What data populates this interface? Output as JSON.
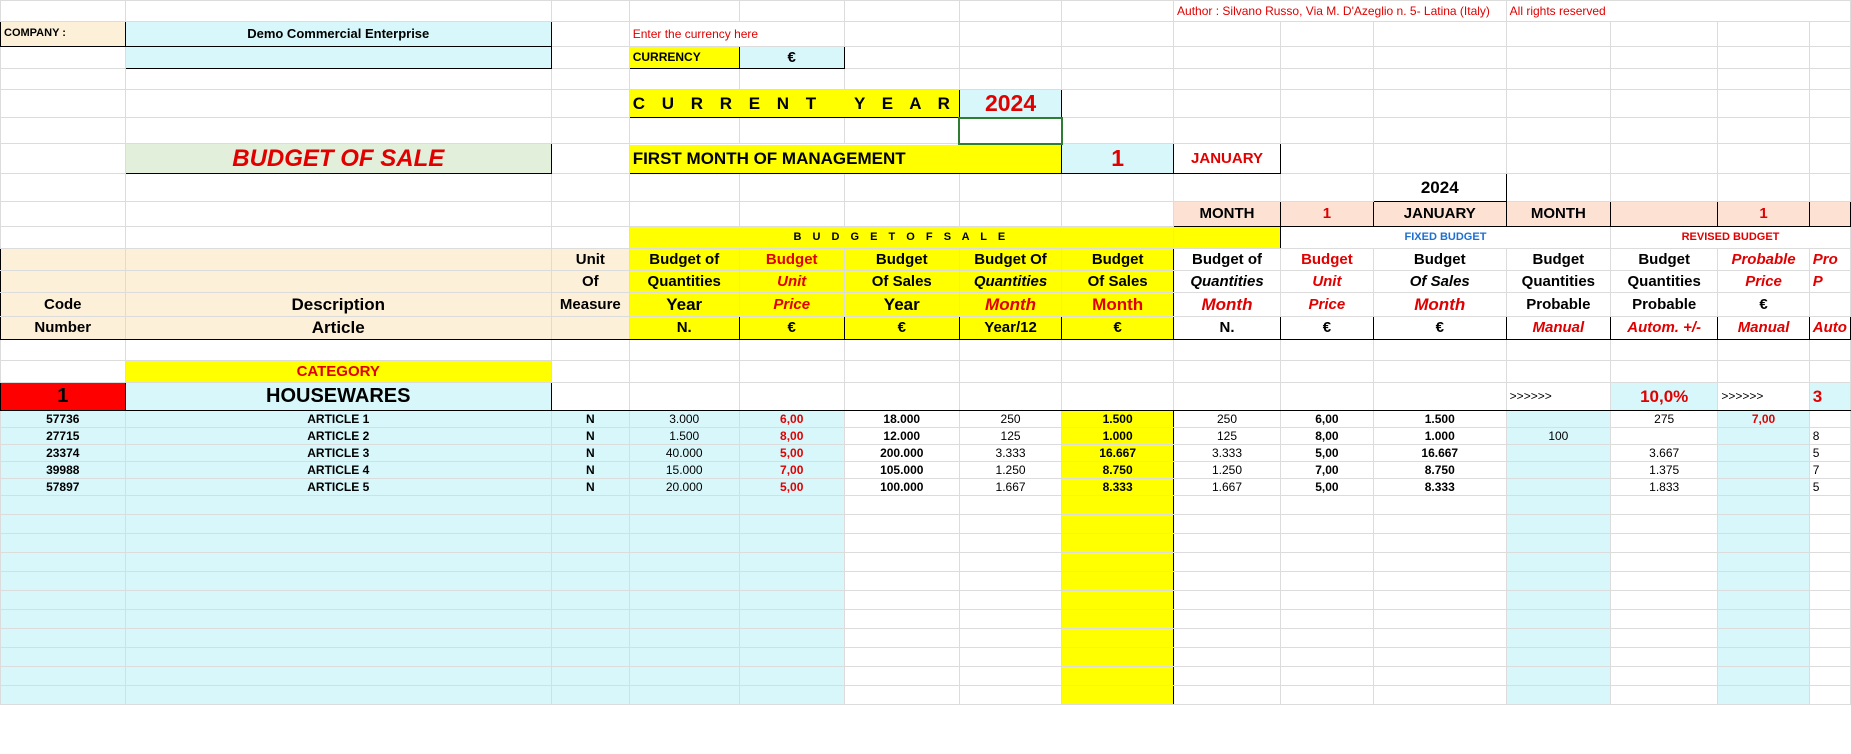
{
  "company": {
    "label": "COMPANY :",
    "name": "Demo Commercial Enterprise"
  },
  "author": "Author : Silvano Russo, Via M. D'Azeglio n. 5- Latina (Italy)",
  "rights": "All rights reserved",
  "currency": {
    "hint": "Enter the currency here",
    "label": "CURRENCY",
    "value": "€"
  },
  "current_year": {
    "label": "C U R R E N T   Y E A R",
    "value": "2024"
  },
  "sheet_title": "BUDGET OF SALE",
  "first_month": {
    "label": "FIRST MONTH OF MANAGEMENT",
    "number": "1",
    "name": "JANUARY"
  },
  "period": {
    "year": "2024",
    "month_label": "MONTH",
    "month_number": "1",
    "month_name": "JANUARY",
    "month_label_2": "MONTH",
    "month_number_2": "1"
  },
  "sections": {
    "budget_of_sale": "B U D G E T   O F   S A L E",
    "fixed_budget": "FIXED BUDGET",
    "revised_budget": "REVISED BUDGET"
  },
  "headers": {
    "code": [
      "Code",
      "Number"
    ],
    "description": [
      "Description",
      "Article"
    ],
    "unit": [
      "Unit",
      "Of",
      "Measure"
    ],
    "bq_year": [
      "Budget of",
      "Quantities",
      "Year",
      "N."
    ],
    "bup": [
      "Budget",
      "Unit",
      "Price",
      "€"
    ],
    "bos_year": [
      "Budget",
      "Of Sales",
      "Year",
      "€"
    ],
    "bq_month": [
      "Budget Of",
      "Quantities",
      "Month",
      "Year/12"
    ],
    "bos_month": [
      "Budget",
      "Of Sales",
      "Month",
      "€"
    ],
    "fb_q": [
      "Budget of",
      "Quantities",
      "Month",
      "N."
    ],
    "fb_p": [
      "Budget",
      "Unit",
      "Price",
      "€"
    ],
    "fb_s": [
      "Budget",
      "Of Sales",
      "Month",
      "€"
    ],
    "rb_qp": [
      "Budget",
      "Quantities",
      "Probable",
      "Manual"
    ],
    "rb_qp2": [
      "Budget",
      "Quantities",
      "Probable",
      "Autom. +/-"
    ],
    "rb_pp": [
      "Probable",
      "Price",
      "€",
      "Manual"
    ],
    "rb_pf": [
      "Pro",
      "P",
      "",
      "Auto"
    ]
  },
  "category": {
    "label": "CATEGORY",
    "number": "1",
    "name": "HOUSEWARES",
    "arrows_1": ">>>>>>",
    "pct": "10,0%",
    "arrows_2": ">>>>>>",
    "cut": "3"
  },
  "rows": [
    {
      "code": "57736",
      "desc": "ARTICLE 1",
      "unit": "N",
      "qy": "3.000",
      "price": "6,00",
      "sy": "18.000",
      "qm": "250",
      "sm": "1.500",
      "fq": "250",
      "fp": "6,00",
      "fs": "1.500",
      "rq": "",
      "rq2": "275",
      "rp": "7,00",
      "rpf": ""
    },
    {
      "code": "27715",
      "desc": "ARTICLE 2",
      "unit": "N",
      "qy": "1.500",
      "price": "8,00",
      "sy": "12.000",
      "qm": "125",
      "sm": "1.000",
      "fq": "125",
      "fp": "8,00",
      "fs": "1.000",
      "rq": "100",
      "rq2": "",
      "rp": "",
      "rpf": "8"
    },
    {
      "code": "23374",
      "desc": "ARTICLE 3",
      "unit": "N",
      "qy": "40.000",
      "price": "5,00",
      "sy": "200.000",
      "qm": "3.333",
      "sm": "16.667",
      "fq": "3.333",
      "fp": "5,00",
      "fs": "16.667",
      "rq": "",
      "rq2": "3.667",
      "rp": "",
      "rpf": "5"
    },
    {
      "code": "39988",
      "desc": "ARTICLE 4",
      "unit": "N",
      "qy": "15.000",
      "price": "7,00",
      "sy": "105.000",
      "qm": "1.250",
      "sm": "8.750",
      "fq": "1.250",
      "fp": "7,00",
      "fs": "8.750",
      "rq": "",
      "rq2": "1.375",
      "rp": "",
      "rpf": "7"
    },
    {
      "code": "57897",
      "desc": "ARTICLE 5",
      "unit": "N",
      "qy": "20.000",
      "price": "5,00",
      "sy": "100.000",
      "qm": "1.667",
      "sm": "8.333",
      "fq": "1.667",
      "fp": "5,00",
      "fs": "8.333",
      "rq": "",
      "rq2": "1.833",
      "rp": "",
      "rpf": "5"
    }
  ],
  "empty_rows": 11
}
